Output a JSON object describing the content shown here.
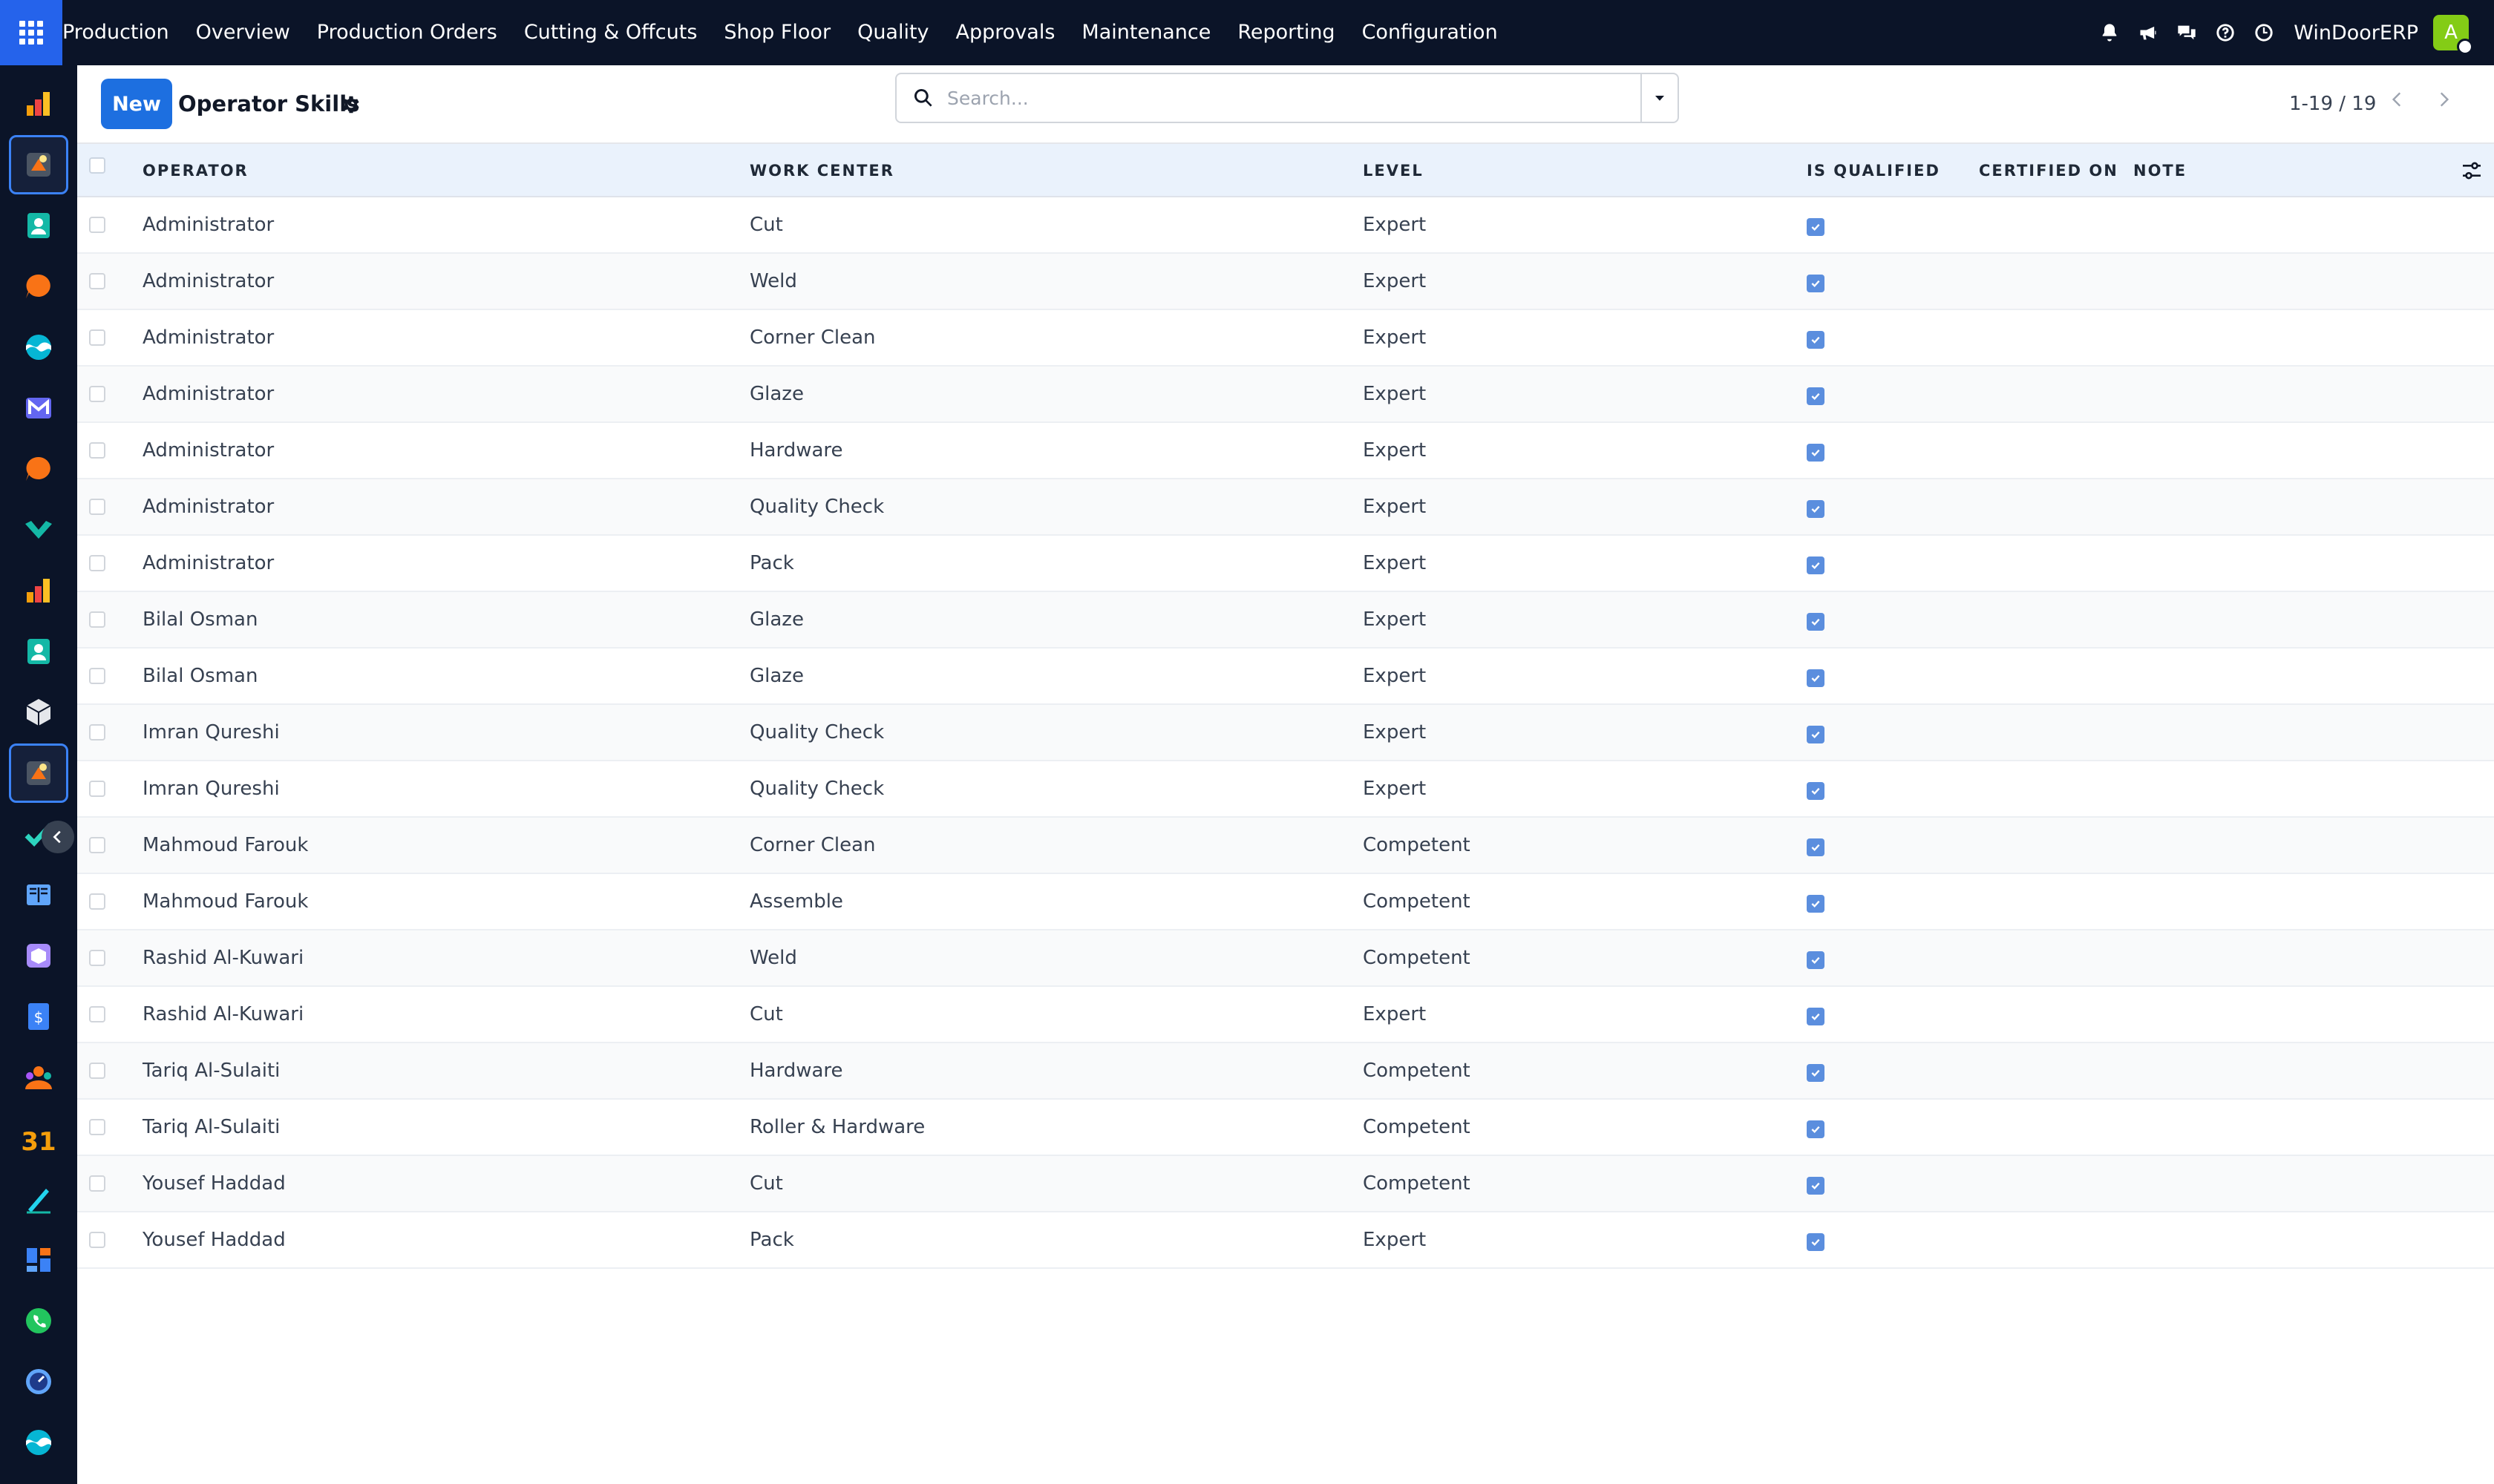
{
  "navbar": {
    "menu": [
      "Production",
      "Overview",
      "Production Orders",
      "Cutting & Offcuts",
      "Shop Floor",
      "Quality",
      "Approvals",
      "Maintenance",
      "Reporting",
      "Configuration"
    ],
    "icons": [
      "bell-icon",
      "megaphone-icon",
      "chat-icon",
      "help-icon",
      "clock-icon"
    ],
    "company": "WinDoorERP",
    "avatar_initial": "A",
    "avatar_color": "#84cc16",
    "background": "#0b1428",
    "apps_color": "#2563eb"
  },
  "control": {
    "new_label": "New",
    "title": "Operator Skills",
    "search_placeholder": "Search...",
    "pager_value": "1-19 / 19"
  },
  "table": {
    "columns": [
      "OPERATOR",
      "WORK CENTER",
      "LEVEL",
      "IS QUALIFIED",
      "CERTIFIED ON",
      "NOTE"
    ],
    "rows": [
      {
        "operator": "Administrator",
        "work_center": "Cut",
        "level": "Expert",
        "qualified": true
      },
      {
        "operator": "Administrator",
        "work_center": "Weld",
        "level": "Expert",
        "qualified": true
      },
      {
        "operator": "Administrator",
        "work_center": "Corner Clean",
        "level": "Expert",
        "qualified": true
      },
      {
        "operator": "Administrator",
        "work_center": "Glaze",
        "level": "Expert",
        "qualified": true
      },
      {
        "operator": "Administrator",
        "work_center": "Hardware",
        "level": "Expert",
        "qualified": true
      },
      {
        "operator": "Administrator",
        "work_center": "Quality Check",
        "level": "Expert",
        "qualified": true
      },
      {
        "operator": "Administrator",
        "work_center": "Pack",
        "level": "Expert",
        "qualified": true
      },
      {
        "operator": "Bilal Osman",
        "work_center": "Glaze",
        "level": "Expert",
        "qualified": true
      },
      {
        "operator": "Bilal Osman",
        "work_center": "Glaze",
        "level": "Expert",
        "qualified": true
      },
      {
        "operator": "Imran Qureshi",
        "work_center": "Quality Check",
        "level": "Expert",
        "qualified": true
      },
      {
        "operator": "Imran Qureshi",
        "work_center": "Quality Check",
        "level": "Expert",
        "qualified": true
      },
      {
        "operator": "Mahmoud Farouk",
        "work_center": "Corner Clean",
        "level": "Competent",
        "qualified": true
      },
      {
        "operator": "Mahmoud Farouk",
        "work_center": "Assemble",
        "level": "Competent",
        "qualified": true
      },
      {
        "operator": "Rashid Al-Kuwari",
        "work_center": "Weld",
        "level": "Competent",
        "qualified": true
      },
      {
        "operator": "Rashid Al-Kuwari",
        "work_center": "Cut",
        "level": "Expert",
        "qualified": true
      },
      {
        "operator": "Tariq Al-Sulaiti",
        "work_center": "Hardware",
        "level": "Competent",
        "qualified": true
      },
      {
        "operator": "Tariq Al-Sulaiti",
        "work_center": "Roller & Hardware",
        "level": "Competent",
        "qualified": true
      },
      {
        "operator": "Yousef Haddad",
        "work_center": "Cut",
        "level": "Competent",
        "qualified": true
      },
      {
        "operator": "Yousef Haddad",
        "work_center": "Pack",
        "level": "Expert",
        "qualified": true
      }
    ]
  },
  "sidebar": {
    "apps": [
      {
        "name": "sidebar-app-reporting",
        "icon": "bar-chart-icon",
        "color": "#f59e0b",
        "active": false
      },
      {
        "name": "sidebar-app-production",
        "icon": "production-icon",
        "color": "#f97316",
        "active": true
      },
      {
        "name": "sidebar-app-contacts",
        "icon": "contacts-icon",
        "color": "#14b8a6",
        "active": false
      },
      {
        "name": "sidebar-app-discuss",
        "icon": "chat-bubble-icon",
        "color": "#f97316",
        "active": false
      },
      {
        "name": "sidebar-app-website",
        "icon": "globe-wave-icon",
        "color": "#06b6d4",
        "active": false
      },
      {
        "name": "sidebar-app-mail",
        "icon": "mail-icon",
        "color": "#6366f1",
        "active": false
      },
      {
        "name": "sidebar-app-livechat",
        "icon": "chat-bubble-icon",
        "color": "#f97316",
        "active": false
      },
      {
        "name": "sidebar-app-sign",
        "icon": "sign-icon",
        "color": "#14b8a6",
        "active": false
      },
      {
        "name": "sidebar-app-dashboards",
        "icon": "bar-chart-icon",
        "color": "#f59e0b",
        "active": false
      },
      {
        "name": "sidebar-app-employees",
        "icon": "contacts-icon",
        "color": "#14b8a6",
        "active": false
      },
      {
        "name": "sidebar-app-inventory",
        "icon": "cube-icon",
        "color": "#e5e7eb",
        "active": false
      },
      {
        "name": "sidebar-app-manufacturing",
        "icon": "production-icon",
        "color": "#f97316",
        "active": true
      },
      {
        "name": "sidebar-app-project",
        "icon": "check-icon",
        "color": "#2dd4bf",
        "active": false
      },
      {
        "name": "sidebar-app-knowledge",
        "icon": "book-icon",
        "color": "#60a5fa",
        "active": false
      },
      {
        "name": "sidebar-app-products",
        "icon": "box-icon",
        "color": "#a78bfa",
        "active": false
      },
      {
        "name": "sidebar-app-invoicing",
        "icon": "invoice-icon",
        "color": "#3b82f6",
        "active": false
      },
      {
        "name": "sidebar-app-team",
        "icon": "team-icon",
        "color": "#f97316",
        "active": false
      },
      {
        "name": "sidebar-app-calendar",
        "icon": "calendar-icon",
        "color": "#f59e0b",
        "active": false
      },
      {
        "name": "sidebar-app-draw",
        "icon": "pen-icon",
        "color": "#22d3ee",
        "active": false
      },
      {
        "name": "sidebar-app-planning",
        "icon": "grid-icon",
        "color": "#3b82f6",
        "active": false
      },
      {
        "name": "sidebar-app-whatsapp",
        "icon": "whatsapp-icon",
        "color": "#22c55e",
        "active": false
      },
      {
        "name": "sidebar-app-timer",
        "icon": "clock-dial-icon",
        "color": "#60a5fa",
        "active": false
      },
      {
        "name": "sidebar-app-website-2",
        "icon": "globe-wave-icon",
        "color": "#06b6d4",
        "active": false
      }
    ],
    "collapse_icon": "chevron-left-icon"
  }
}
